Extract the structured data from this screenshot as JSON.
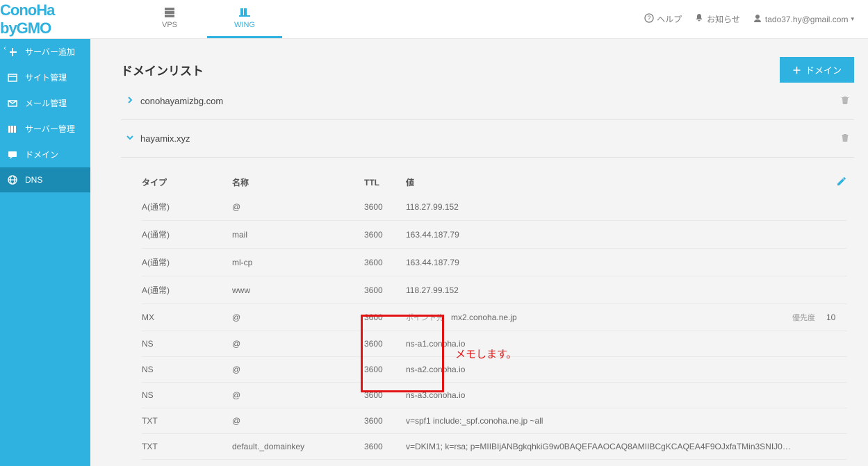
{
  "brand": {
    "name": "ConoHa",
    "sub": "byGMO"
  },
  "tabs": {
    "vps": "VPS",
    "wing": "WING"
  },
  "header": {
    "help": "ヘルプ",
    "notice": "お知らせ",
    "user": "tado37.hy@gmail.com"
  },
  "sidebar_toggle": "‹",
  "sidebar": [
    {
      "id": "add-server",
      "label": "サーバー追加",
      "icon": "plus"
    },
    {
      "id": "site",
      "label": "サイト管理",
      "icon": "window"
    },
    {
      "id": "mail",
      "label": "メール管理",
      "icon": "mail"
    },
    {
      "id": "server",
      "label": "サーバー管理",
      "icon": "books"
    },
    {
      "id": "domain",
      "label": "ドメイン",
      "icon": "chat"
    },
    {
      "id": "dns",
      "label": "DNS",
      "icon": "globe",
      "active": true
    }
  ],
  "page": {
    "title": "ドメインリスト",
    "add_domain": "ドメイン"
  },
  "domains": [
    {
      "name": "conohayamizbg.com",
      "open": false
    },
    {
      "name": "hayamix.xyz",
      "open": true
    }
  ],
  "dns_headers": {
    "type": "タイプ",
    "name": "名称",
    "ttl": "TTL",
    "value": "値"
  },
  "mx_labels": {
    "pointer": "ポイント先",
    "priority": "優先度"
  },
  "records": [
    {
      "type": "A(通常)",
      "name": "@",
      "ttl": "3600",
      "value": "118.27.99.152"
    },
    {
      "type": "A(通常)",
      "name": "mail",
      "ttl": "3600",
      "value": "163.44.187.79"
    },
    {
      "type": "A(通常)",
      "name": "ml-cp",
      "ttl": "3600",
      "value": "163.44.187.79"
    },
    {
      "type": "A(通常)",
      "name": "www",
      "ttl": "3600",
      "value": "118.27.99.152"
    },
    {
      "type": "MX",
      "name": "@",
      "ttl": "3600",
      "value": "mx2.conoha.ne.jp",
      "mx": true,
      "priority": "10"
    },
    {
      "type": "NS",
      "name": "@",
      "ttl": "3600",
      "value": "ns-a1.conoha.io"
    },
    {
      "type": "NS",
      "name": "@",
      "ttl": "3600",
      "value": "ns-a2.conoha.io"
    },
    {
      "type": "NS",
      "name": "@",
      "ttl": "3600",
      "value": "ns-a3.conoha.io"
    },
    {
      "type": "TXT",
      "name": "@",
      "ttl": "3600",
      "value": "v=spf1 include:_spf.conoha.ne.jp ~all"
    },
    {
      "type": "TXT",
      "name": "default._domainkey",
      "ttl": "3600",
      "value": "v=DKIM1; k=rsa; p=MIIBIjANBgkqhkiG9w0BAQEFAAOCAQ8AMIIBCgKCAQEA4F9OJxfaTMin3SNIJ0…"
    }
  ],
  "annotation": "メモします。"
}
